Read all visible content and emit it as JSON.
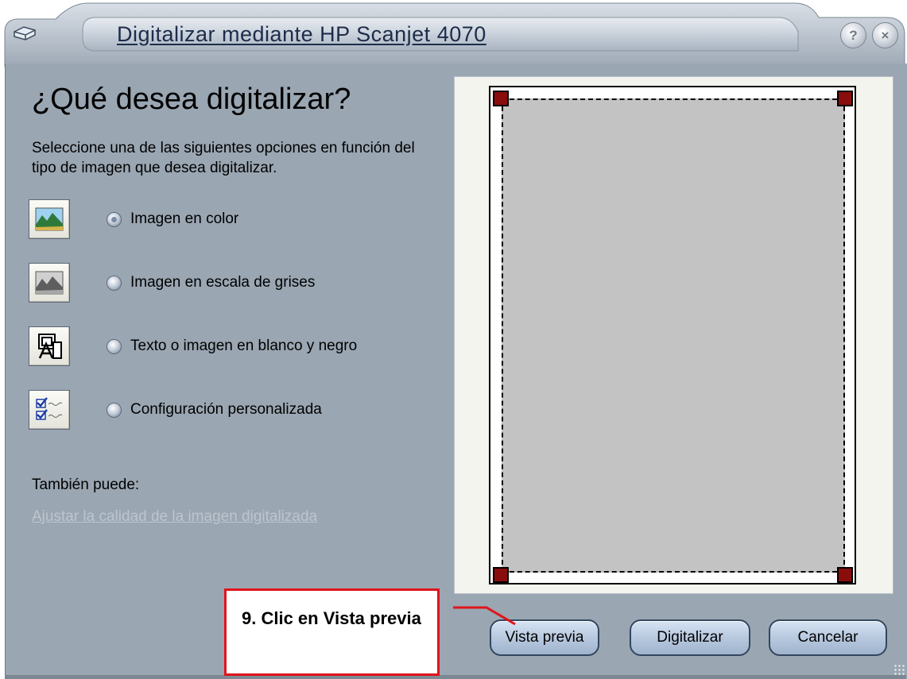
{
  "window": {
    "title": "Digitalizar mediante HP Scanjet 4070",
    "help_symbol": "?",
    "close_symbol": "×"
  },
  "main": {
    "heading": "¿Qué desea digitalizar?",
    "instructions": "Seleccione una de las siguientes opciones en función del tipo de imagen que desea digitalizar.",
    "options": [
      {
        "label": "Imagen en color",
        "icon": "color-photo-icon",
        "selected": true
      },
      {
        "label": "Imagen en escala de grises",
        "icon": "grayscale-photo-icon",
        "selected": false
      },
      {
        "label": "Texto o imagen en blanco y negro",
        "icon": "black-white-text-icon",
        "selected": false
      },
      {
        "label": "Configuración personalizada",
        "icon": "custom-settings-icon",
        "selected": false
      }
    ],
    "also_label": "También puede:",
    "adjust_link": "Ajustar la calidad de la imagen digitalizada"
  },
  "buttons": {
    "preview": "Vista previa",
    "scan": "Digitalizar",
    "cancel": "Cancelar"
  },
  "callout": {
    "text": "9. Clic en Vista previa",
    "color": "#e0141b"
  },
  "colors": {
    "panel": "#9aa6b2",
    "handle": "#8a0d0d",
    "crop_fill": "#c3c3c3"
  }
}
